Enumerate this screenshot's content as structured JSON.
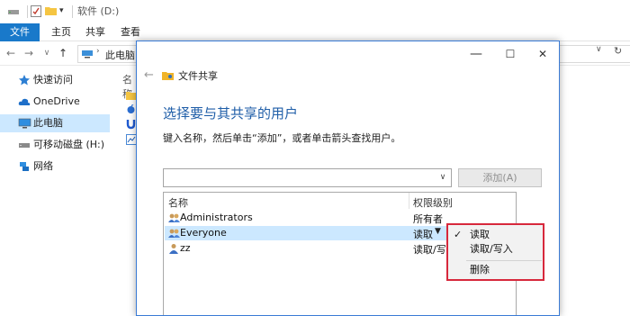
{
  "window": {
    "title": "软件 (D:)",
    "controls": {
      "min": "—",
      "max": "☐",
      "close": "✕"
    }
  },
  "ribbon": {
    "tabs": [
      {
        "label": "文件"
      },
      {
        "label": "主页"
      },
      {
        "label": "共享"
      },
      {
        "label": "查看"
      }
    ]
  },
  "address": {
    "back": "←",
    "forward": "→",
    "dropdown": "∨",
    "up": "↑",
    "path": "此电脑"
  },
  "sidebar": {
    "items": [
      {
        "label": "快速访问"
      },
      {
        "label": "OneDrive"
      },
      {
        "label": "此电脑"
      },
      {
        "label": "可移动磁盘 (H:)"
      },
      {
        "label": "网络"
      }
    ]
  },
  "content": {
    "column_header": "名称"
  },
  "dialog": {
    "back": "←",
    "title": "文件共享",
    "heading": "选择要与其共享的用户",
    "instruction": "键入名称，然后单击“添加”，或者单击箭头查找用户。",
    "name_input_value": "",
    "add_button": "添加(A)",
    "list": {
      "col_name": "名称",
      "col_permission": "权限级别",
      "rows": [
        {
          "name": "Administrators",
          "permission": "所有者"
        },
        {
          "name": "Everyone",
          "permission": "读取"
        },
        {
          "name": "zz",
          "permission": "读取/写..."
        }
      ]
    }
  },
  "context_menu": {
    "items": [
      {
        "label": "读取",
        "checked": "✓"
      },
      {
        "label": "读取/写入"
      },
      {
        "label": "删除"
      }
    ]
  },
  "colors": {
    "accent": "#1979ca",
    "heading": "#1f5ea8",
    "selection": "#cce8ff",
    "highlight_box": "#d7283c"
  }
}
